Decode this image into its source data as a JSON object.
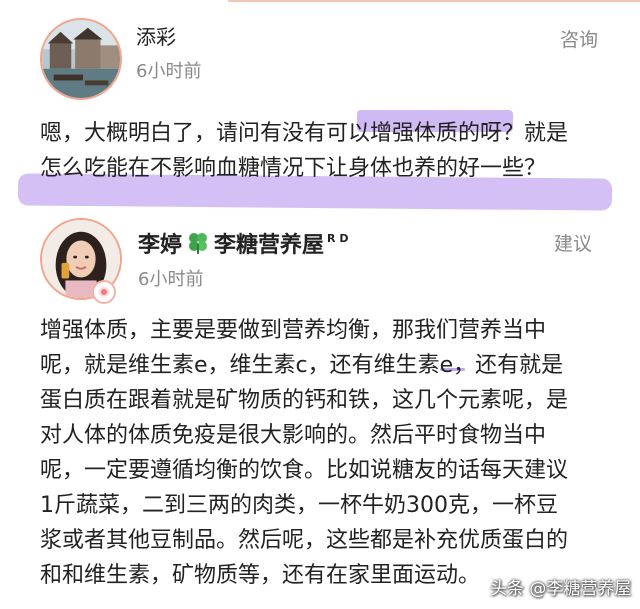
{
  "comment1": {
    "user_name": "添彩",
    "time": "6小时前",
    "tag": "咨询",
    "text_lines": [
      "嗯，大概明白了，请问有没有可以增强体质的呀？就是",
      "怎么吃能在不影响血糖情况下让身体也养的好一些？"
    ]
  },
  "comment2": {
    "user_first": "李婷",
    "user_second": "李糖营养屋",
    "user_mark": "R D",
    "time": "6小时前",
    "tag": "建议",
    "text_lines": [
      "增强体质，主要是要做到营养均衡，那我们营养当中",
      "呢，就是维生素e，维生素c，还有维生素e，还有就是",
      "蛋白质在跟着就是矿物质的钙和铁，这几个元素呢，是",
      "对人体的体质免疫是很大影响的。然后平时食物当中",
      "呢，一定要遵循均衡的饮食。比如说糖友的话每天建议",
      "1斤蔬菜，二到三两的肉类，一杯牛奶300克，一杯豆",
      "浆或者其他豆制品。然后呢，这些都是补充优质蛋白的",
      "和和维生素，矿物质等，还有在家里面运动。"
    ]
  },
  "watermark": "头条 @李糖营养屋",
  "colors": {
    "highlight": "#aa82eb",
    "avatar_border": "#f2a58c",
    "meta_text": "#8a8a8a"
  },
  "icons": [
    "clover-icon",
    "verified-badge-icon"
  ]
}
